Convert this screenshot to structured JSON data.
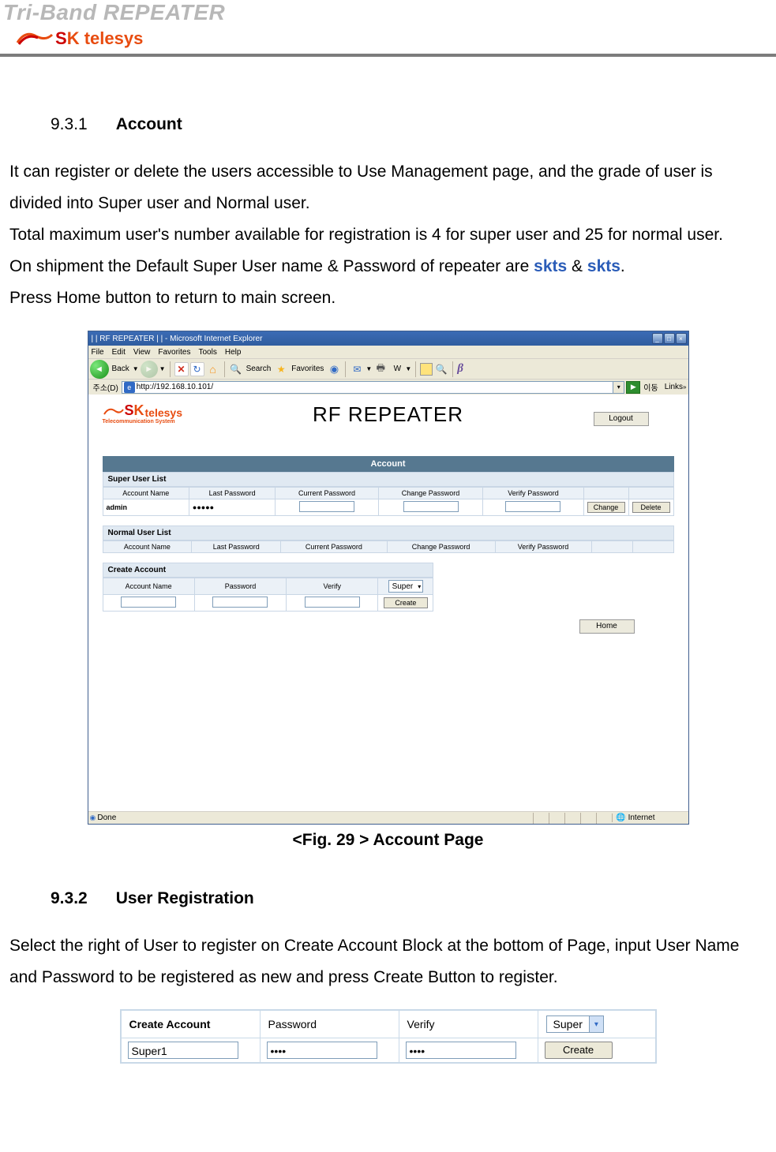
{
  "header": {
    "doc_title": "Tri-Band REPEATER",
    "logo_brand_s": "S",
    "logo_brand_k": "K",
    "logo_telesys": "telesys"
  },
  "section1": {
    "number": "9.3.1",
    "title": "Account",
    "para1": "It can register or delete the users accessible to Use Management page, and the grade of user is divided into Super user and Normal user.",
    "para2_a": "Total maximum user's number available for registration is 4 for super user and 25 for normal user.",
    "para3_a": "On shipment the Default Super User name & Password of repeater are ",
    "para3_skts1": "skts",
    "para3_amp": " & ",
    "para3_skts2": "skts",
    "para3_b": ".",
    "para4": "Press Home button to return to main screen."
  },
  "fig29": {
    "caption": "<Fig. 29 > Account Page",
    "ie_title": "| | RF REPEATER | | - Microsoft Internet Explorer",
    "menu": {
      "file": "File",
      "edit": "Edit",
      "view": "View",
      "favorites": "Favorites",
      "tools": "Tools",
      "help": "Help"
    },
    "toolbar": {
      "back": "Back",
      "search": "Search",
      "favorites": "Favorites"
    },
    "address_label": "주소(D)",
    "address_url": "http://192.168.10.101/",
    "go_label": "이동",
    "links_label": "Links",
    "rf_title": "RF REPEATER",
    "telesys_sub": "Telecommunication System",
    "logout": "Logout",
    "account_header": "Account",
    "super_list": "Super User List",
    "normal_list": "Normal User List",
    "cols": {
      "account_name": "Account Name",
      "last_pw": "Last Password",
      "current_pw": "Current Password",
      "change_pw": "Change Password",
      "verify_pw": "Verify Password"
    },
    "admin": "admin",
    "admin_pw": "●●●●●",
    "change_btn": "Change",
    "delete_btn": "Delete",
    "create_account": "Create Account",
    "create_cols": {
      "account_name": "Account Name",
      "password": "Password",
      "verify": "Verify"
    },
    "super_option": "Super",
    "create_btn": "Create",
    "home_btn": "Home",
    "status_done": "Done",
    "status_internet": "Internet"
  },
  "section2": {
    "number": "9.3.2",
    "title": "User Registration",
    "para1": "Select the right of User to register on Create Account Block at the bottom of Page, input User Name and Password to be registered as new and press Create Button to register."
  },
  "snip": {
    "create_account": "Create Account",
    "password": "Password",
    "verify": "Verify",
    "super": "Super",
    "account_value": "Super1",
    "pw_value": "••••",
    "verify_value": "••••",
    "create_btn": "Create"
  }
}
